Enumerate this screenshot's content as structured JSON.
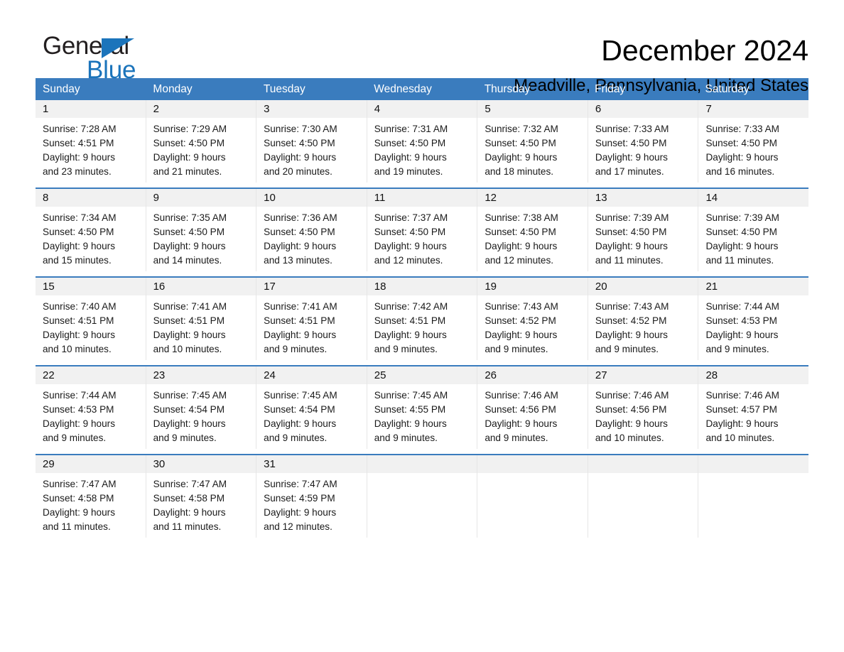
{
  "logo": {
    "word_one": "General",
    "word_two": "Blue",
    "triangle_color": "#1b74bb"
  },
  "header": {
    "title": "December 2024",
    "location": "Meadville, Pennsylvania, United States"
  },
  "theme": {
    "header_blue": "#3a7cbe",
    "daynum_bg": "#f1f1f1",
    "text": "#000000"
  },
  "weekdays": [
    "Sunday",
    "Monday",
    "Tuesday",
    "Wednesday",
    "Thursday",
    "Friday",
    "Saturday"
  ],
  "weeks": [
    [
      {
        "day": "1",
        "sunrise": "Sunrise: 7:28 AM",
        "sunset": "Sunset: 4:51 PM",
        "daylight1": "Daylight: 9 hours",
        "daylight2": "and 23 minutes."
      },
      {
        "day": "2",
        "sunrise": "Sunrise: 7:29 AM",
        "sunset": "Sunset: 4:50 PM",
        "daylight1": "Daylight: 9 hours",
        "daylight2": "and 21 minutes."
      },
      {
        "day": "3",
        "sunrise": "Sunrise: 7:30 AM",
        "sunset": "Sunset: 4:50 PM",
        "daylight1": "Daylight: 9 hours",
        "daylight2": "and 20 minutes."
      },
      {
        "day": "4",
        "sunrise": "Sunrise: 7:31 AM",
        "sunset": "Sunset: 4:50 PM",
        "daylight1": "Daylight: 9 hours",
        "daylight2": "and 19 minutes."
      },
      {
        "day": "5",
        "sunrise": "Sunrise: 7:32 AM",
        "sunset": "Sunset: 4:50 PM",
        "daylight1": "Daylight: 9 hours",
        "daylight2": "and 18 minutes."
      },
      {
        "day": "6",
        "sunrise": "Sunrise: 7:33 AM",
        "sunset": "Sunset: 4:50 PM",
        "daylight1": "Daylight: 9 hours",
        "daylight2": "and 17 minutes."
      },
      {
        "day": "7",
        "sunrise": "Sunrise: 7:33 AM",
        "sunset": "Sunset: 4:50 PM",
        "daylight1": "Daylight: 9 hours",
        "daylight2": "and 16 minutes."
      }
    ],
    [
      {
        "day": "8",
        "sunrise": "Sunrise: 7:34 AM",
        "sunset": "Sunset: 4:50 PM",
        "daylight1": "Daylight: 9 hours",
        "daylight2": "and 15 minutes."
      },
      {
        "day": "9",
        "sunrise": "Sunrise: 7:35 AM",
        "sunset": "Sunset: 4:50 PM",
        "daylight1": "Daylight: 9 hours",
        "daylight2": "and 14 minutes."
      },
      {
        "day": "10",
        "sunrise": "Sunrise: 7:36 AM",
        "sunset": "Sunset: 4:50 PM",
        "daylight1": "Daylight: 9 hours",
        "daylight2": "and 13 minutes."
      },
      {
        "day": "11",
        "sunrise": "Sunrise: 7:37 AM",
        "sunset": "Sunset: 4:50 PM",
        "daylight1": "Daylight: 9 hours",
        "daylight2": "and 12 minutes."
      },
      {
        "day": "12",
        "sunrise": "Sunrise: 7:38 AM",
        "sunset": "Sunset: 4:50 PM",
        "daylight1": "Daylight: 9 hours",
        "daylight2": "and 12 minutes."
      },
      {
        "day": "13",
        "sunrise": "Sunrise: 7:39 AM",
        "sunset": "Sunset: 4:50 PM",
        "daylight1": "Daylight: 9 hours",
        "daylight2": "and 11 minutes."
      },
      {
        "day": "14",
        "sunrise": "Sunrise: 7:39 AM",
        "sunset": "Sunset: 4:50 PM",
        "daylight1": "Daylight: 9 hours",
        "daylight2": "and 11 minutes."
      }
    ],
    [
      {
        "day": "15",
        "sunrise": "Sunrise: 7:40 AM",
        "sunset": "Sunset: 4:51 PM",
        "daylight1": "Daylight: 9 hours",
        "daylight2": "and 10 minutes."
      },
      {
        "day": "16",
        "sunrise": "Sunrise: 7:41 AM",
        "sunset": "Sunset: 4:51 PM",
        "daylight1": "Daylight: 9 hours",
        "daylight2": "and 10 minutes."
      },
      {
        "day": "17",
        "sunrise": "Sunrise: 7:41 AM",
        "sunset": "Sunset: 4:51 PM",
        "daylight1": "Daylight: 9 hours",
        "daylight2": "and 9 minutes."
      },
      {
        "day": "18",
        "sunrise": "Sunrise: 7:42 AM",
        "sunset": "Sunset: 4:51 PM",
        "daylight1": "Daylight: 9 hours",
        "daylight2": "and 9 minutes."
      },
      {
        "day": "19",
        "sunrise": "Sunrise: 7:43 AM",
        "sunset": "Sunset: 4:52 PM",
        "daylight1": "Daylight: 9 hours",
        "daylight2": "and 9 minutes."
      },
      {
        "day": "20",
        "sunrise": "Sunrise: 7:43 AM",
        "sunset": "Sunset: 4:52 PM",
        "daylight1": "Daylight: 9 hours",
        "daylight2": "and 9 minutes."
      },
      {
        "day": "21",
        "sunrise": "Sunrise: 7:44 AM",
        "sunset": "Sunset: 4:53 PM",
        "daylight1": "Daylight: 9 hours",
        "daylight2": "and 9 minutes."
      }
    ],
    [
      {
        "day": "22",
        "sunrise": "Sunrise: 7:44 AM",
        "sunset": "Sunset: 4:53 PM",
        "daylight1": "Daylight: 9 hours",
        "daylight2": "and 9 minutes."
      },
      {
        "day": "23",
        "sunrise": "Sunrise: 7:45 AM",
        "sunset": "Sunset: 4:54 PM",
        "daylight1": "Daylight: 9 hours",
        "daylight2": "and 9 minutes."
      },
      {
        "day": "24",
        "sunrise": "Sunrise: 7:45 AM",
        "sunset": "Sunset: 4:54 PM",
        "daylight1": "Daylight: 9 hours",
        "daylight2": "and 9 minutes."
      },
      {
        "day": "25",
        "sunrise": "Sunrise: 7:45 AM",
        "sunset": "Sunset: 4:55 PM",
        "daylight1": "Daylight: 9 hours",
        "daylight2": "and 9 minutes."
      },
      {
        "day": "26",
        "sunrise": "Sunrise: 7:46 AM",
        "sunset": "Sunset: 4:56 PM",
        "daylight1": "Daylight: 9 hours",
        "daylight2": "and 9 minutes."
      },
      {
        "day": "27",
        "sunrise": "Sunrise: 7:46 AM",
        "sunset": "Sunset: 4:56 PM",
        "daylight1": "Daylight: 9 hours",
        "daylight2": "and 10 minutes."
      },
      {
        "day": "28",
        "sunrise": "Sunrise: 7:46 AM",
        "sunset": "Sunset: 4:57 PM",
        "daylight1": "Daylight: 9 hours",
        "daylight2": "and 10 minutes."
      }
    ],
    [
      {
        "day": "29",
        "sunrise": "Sunrise: 7:47 AM",
        "sunset": "Sunset: 4:58 PM",
        "daylight1": "Daylight: 9 hours",
        "daylight2": "and 11 minutes."
      },
      {
        "day": "30",
        "sunrise": "Sunrise: 7:47 AM",
        "sunset": "Sunset: 4:58 PM",
        "daylight1": "Daylight: 9 hours",
        "daylight2": "and 11 minutes."
      },
      {
        "day": "31",
        "sunrise": "Sunrise: 7:47 AM",
        "sunset": "Sunset: 4:59 PM",
        "daylight1": "Daylight: 9 hours",
        "daylight2": "and 12 minutes."
      },
      {
        "day": "",
        "sunrise": "",
        "sunset": "",
        "daylight1": "",
        "daylight2": ""
      },
      {
        "day": "",
        "sunrise": "",
        "sunset": "",
        "daylight1": "",
        "daylight2": ""
      },
      {
        "day": "",
        "sunrise": "",
        "sunset": "",
        "daylight1": "",
        "daylight2": ""
      },
      {
        "day": "",
        "sunrise": "",
        "sunset": "",
        "daylight1": "",
        "daylight2": ""
      }
    ]
  ]
}
